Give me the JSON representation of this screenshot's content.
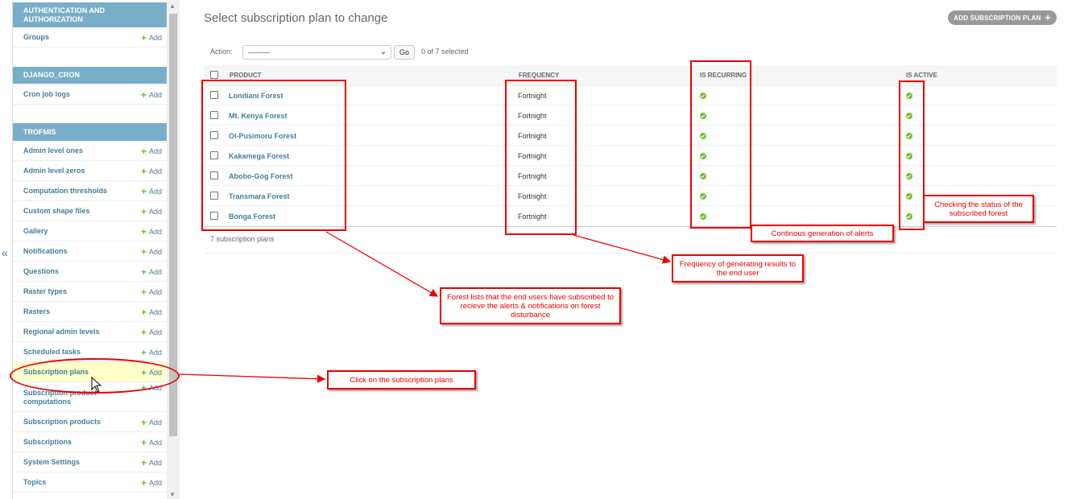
{
  "sidebar": {
    "sections": [
      {
        "title": "AUTHENTICATION AND AUTHORIZATION",
        "items": [
          {
            "label": "Groups",
            "add": "Add"
          }
        ]
      },
      {
        "title": "DJANGO_CRON",
        "items": [
          {
            "label": "Cron job logs",
            "add": "Add"
          }
        ]
      },
      {
        "title": "TROFMIS",
        "items": [
          {
            "label": "Admin level ones",
            "add": "Add"
          },
          {
            "label": "Admin level zeros",
            "add": "Add"
          },
          {
            "label": "Computation thresholds",
            "add": "Add"
          },
          {
            "label": "Custom shape files",
            "add": "Add"
          },
          {
            "label": "Gallery",
            "add": "Add"
          },
          {
            "label": "Notifications",
            "add": "Add"
          },
          {
            "label": "Questions",
            "add": "Add"
          },
          {
            "label": "Raster types",
            "add": "Add"
          },
          {
            "label": "Rasters",
            "add": "Add"
          },
          {
            "label": "Regional admin levels",
            "add": "Add"
          },
          {
            "label": "Scheduled tasks",
            "add": "Add"
          },
          {
            "label": "Subscription plans",
            "add": "Add"
          },
          {
            "label": "Subscription product computations",
            "add": "Add"
          },
          {
            "label": "Subscription products",
            "add": "Add"
          },
          {
            "label": "Subscriptions",
            "add": "Add"
          },
          {
            "label": "System Settings",
            "add": "Add"
          },
          {
            "label": "Topics",
            "add": "Add"
          }
        ]
      }
    ],
    "toggle": "«"
  },
  "main": {
    "title": "Select subscription plan to change",
    "add_button": "ADD SUBSCRIPTION PLAN",
    "action_label": "Action:",
    "action_value": "---------",
    "go": "Go",
    "selected": "0 of 7 selected",
    "columns": [
      "PRODUCT",
      "FREQUENCY",
      "IS RECURRING",
      "IS ACTIVE"
    ],
    "rows": [
      {
        "product": "Londiani Forest",
        "frequency": "Fortnight",
        "is_recurring": true,
        "is_active": true
      },
      {
        "product": "Mt. Kenya Forest",
        "frequency": "Fortnight",
        "is_recurring": true,
        "is_active": true
      },
      {
        "product": "Ol-Pusimoru Forest",
        "frequency": "Fortnight",
        "is_recurring": true,
        "is_active": true
      },
      {
        "product": "Kakamega Forest",
        "frequency": "Fortnight",
        "is_recurring": true,
        "is_active": true
      },
      {
        "product": "Abobo-Gog Forest",
        "frequency": "Fortnight",
        "is_recurring": true,
        "is_active": true
      },
      {
        "product": "Transmara Forest",
        "frequency": "Fortnight",
        "is_recurring": true,
        "is_active": true
      },
      {
        "product": "Bonga Forest",
        "frequency": "Fortnight",
        "is_recurring": true,
        "is_active": true
      }
    ],
    "count": "7 subscription plans"
  },
  "annotations": {
    "status": "Checking the status of the subscribed forest",
    "recurring": "Continous generation of alerts",
    "frequency": "Frequency of generating results to the end user",
    "forests": "Forest lists that the end users have subscribed to recieve the alerts & notifications on forest disturbance",
    "click": "Click on the subscription plans"
  },
  "colors": {
    "link": "#447e9b",
    "section": "#79aec8",
    "annotation": "#e00000",
    "yes": "#70bf2b"
  }
}
